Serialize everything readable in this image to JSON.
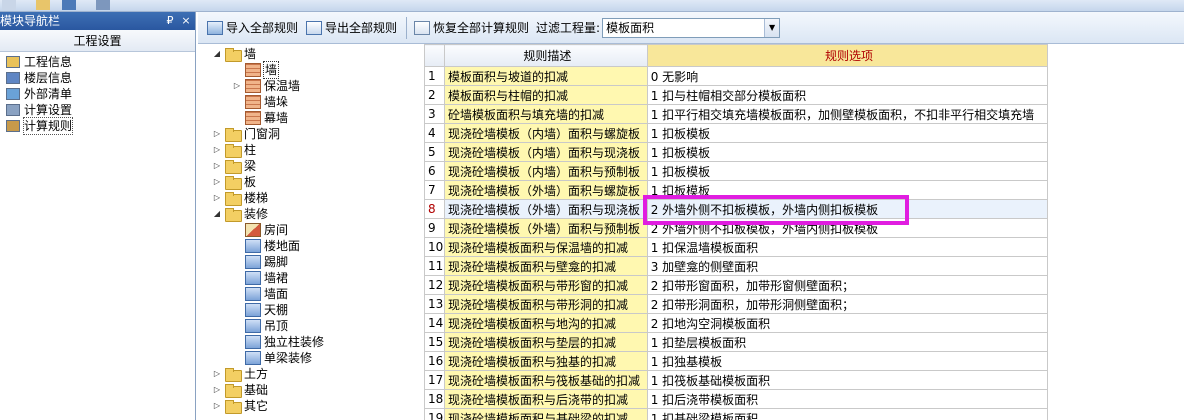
{
  "navigator": {
    "title": "模块导航栏",
    "pin_label": "₽",
    "close_label": "×",
    "group_label": "工程设置",
    "items": [
      {
        "label": "工程信息",
        "icon": "info-icon"
      },
      {
        "label": "楼层信息",
        "icon": "floors-icon"
      },
      {
        "label": "外部清单",
        "icon": "external-list-icon"
      },
      {
        "label": "计算设置",
        "icon": "calc-settings-icon"
      },
      {
        "label": "计算规则",
        "icon": "calc-rules-icon"
      }
    ]
  },
  "toolbar": {
    "import_label": "导入全部规则",
    "export_label": "导出全部规则",
    "restore_label": "恢复全部计算规则",
    "filter_label": "过滤工程量:",
    "filter_value": "模板面积"
  },
  "tree": [
    {
      "label": "墙",
      "level": 0,
      "expand": "open",
      "kind": "folder"
    },
    {
      "label": "墙",
      "level": 1,
      "expand": "",
      "kind": "brick",
      "selected": true
    },
    {
      "label": "保温墙",
      "level": 1,
      "expand": "closed",
      "kind": "brick"
    },
    {
      "label": "墙垛",
      "level": 1,
      "expand": "",
      "kind": "brick"
    },
    {
      "label": "幕墙",
      "level": 1,
      "expand": "",
      "kind": "brick"
    },
    {
      "label": "门窗洞",
      "level": 0,
      "expand": "closed",
      "kind": "folder"
    },
    {
      "label": "柱",
      "level": 0,
      "expand": "closed",
      "kind": "folder"
    },
    {
      "label": "梁",
      "level": 0,
      "expand": "closed",
      "kind": "folder"
    },
    {
      "label": "板",
      "level": 0,
      "expand": "closed",
      "kind": "folder"
    },
    {
      "label": "楼梯",
      "level": 0,
      "expand": "closed",
      "kind": "folder"
    },
    {
      "label": "装修",
      "level": 0,
      "expand": "open",
      "kind": "folder"
    },
    {
      "label": "房间",
      "level": 1,
      "expand": "",
      "kind": "room"
    },
    {
      "label": "楼地面",
      "level": 1,
      "expand": "",
      "kind": "blue"
    },
    {
      "label": "踢脚",
      "level": 1,
      "expand": "",
      "kind": "blue"
    },
    {
      "label": "墙裙",
      "level": 1,
      "expand": "",
      "kind": "blue"
    },
    {
      "label": "墙面",
      "level": 1,
      "expand": "",
      "kind": "blue"
    },
    {
      "label": "天棚",
      "level": 1,
      "expand": "",
      "kind": "blue"
    },
    {
      "label": "吊顶",
      "level": 1,
      "expand": "",
      "kind": "blue"
    },
    {
      "label": "独立柱装修",
      "level": 1,
      "expand": "",
      "kind": "blue"
    },
    {
      "label": "单梁装修",
      "level": 1,
      "expand": "",
      "kind": "blue"
    },
    {
      "label": "土方",
      "level": 0,
      "expand": "closed",
      "kind": "folder"
    },
    {
      "label": "基础",
      "level": 0,
      "expand": "closed",
      "kind": "folder"
    },
    {
      "label": "其它",
      "level": 0,
      "expand": "closed",
      "kind": "folder"
    }
  ],
  "grid": {
    "headers": {
      "index": "",
      "desc": "规则描述",
      "option": "规则选项"
    },
    "rows": [
      {
        "n": "1",
        "desc": "模板面积与坡道的扣减",
        "opt": "0  无影响"
      },
      {
        "n": "2",
        "desc": "模板面积与柱帽的扣减",
        "opt": "1 扣与柱帽相交部分模板面积"
      },
      {
        "n": "3",
        "desc": "砼墙模板面积与填充墙的扣减",
        "opt": "1 扣平行相交填充墙模板面积，加侧壁模板面积，不扣非平行相交填充墙"
      },
      {
        "n": "4",
        "desc": "现浇砼墙模板（内墙）面积与螺旋板",
        "opt": "1  扣板模板"
      },
      {
        "n": "5",
        "desc": "现浇砼墙模板（内墙）面积与现浇板",
        "opt": "1  扣板模板"
      },
      {
        "n": "6",
        "desc": "现浇砼墙模板（内墙）面积与预制板",
        "opt": "1  扣板模板"
      },
      {
        "n": "7",
        "desc": "现浇砼墙模板（外墙）面积与螺旋板",
        "opt": "1  扣板模板"
      },
      {
        "n": "8",
        "desc": "现浇砼墙模板（外墙）面积与现浇板",
        "opt": "2  外墙外侧不扣板模板，外墙内侧扣板模板",
        "current": true
      },
      {
        "n": "9",
        "desc": "现浇砼墙模板（外墙）面积与预制板",
        "opt": "2  外墙外侧不扣板模板，外墙内侧扣板模板"
      },
      {
        "n": "10",
        "desc": "现浇砼墙模板面积与保温墙的扣减",
        "opt": "1  扣保温墙模板面积"
      },
      {
        "n": "11",
        "desc": "现浇砼墙模板面积与壁龛的扣减",
        "opt": "3  加壁龛的侧壁面积"
      },
      {
        "n": "12",
        "desc": "现浇砼墙模板面积与带形窗的扣减",
        "opt": "2  扣带形窗面积，加带形窗侧壁面积；"
      },
      {
        "n": "13",
        "desc": "现浇砼墙模板面积与带形洞的扣减",
        "opt": "2  扣带形洞面积，加带形洞侧壁面积；"
      },
      {
        "n": "14",
        "desc": "现浇砼墙模板面积与地沟的扣减",
        "opt": "2  扣地沟空洞模板面积"
      },
      {
        "n": "15",
        "desc": "现浇砼墙模板面积与垫层的扣减",
        "opt": "1  扣垫层模板面积"
      },
      {
        "n": "16",
        "desc": "现浇砼墙模板面积与独基的扣减",
        "opt": "1  扣独基模板"
      },
      {
        "n": "17",
        "desc": "现浇砼墙模板面积与筏板基础的扣减",
        "opt": "1  扣筏板基础模板面积"
      },
      {
        "n": "18",
        "desc": "现浇砼墙模板面积与后浇带的扣减",
        "opt": "1  扣后浇带模板面积"
      },
      {
        "n": "19",
        "desc": "现浇砼墙模板面积与基础梁的扣减",
        "opt": "1  扣基础梁模板面积"
      }
    ]
  },
  "colors": {
    "highlight": "#e01de0",
    "header_accent": "#b00000",
    "desc_bg": "#fff8b0"
  }
}
